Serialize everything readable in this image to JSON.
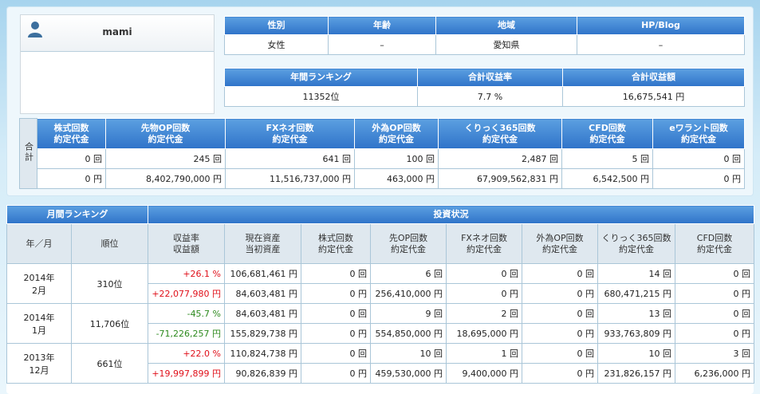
{
  "profile": {
    "name": "mami"
  },
  "info_table": {
    "headers": [
      "性別",
      "年齢",
      "地域",
      "HP/Blog"
    ],
    "values": [
      "女性",
      "–",
      "愛知県",
      "–"
    ]
  },
  "ranking_table": {
    "headers": [
      "年間ランキング",
      "合計収益率",
      "合計収益額"
    ],
    "values": [
      "11352位",
      "7.7 %",
      "16,675,541 円"
    ]
  },
  "totals_table": {
    "side_label": "合計",
    "headers": [
      [
        "株式回数",
        "約定代金"
      ],
      [
        "先物OP回数",
        "約定代金"
      ],
      [
        "FXネオ回数",
        "約定代金"
      ],
      [
        "外為OP回数",
        "約定代金"
      ],
      [
        "くりっく365回数",
        "約定代金"
      ],
      [
        "CFD回数",
        "約定代金"
      ],
      [
        "eワラント回数",
        "約定代金"
      ]
    ],
    "counts": [
      "0 回",
      "245 回",
      "641 回",
      "100 回",
      "2,487 回",
      "5 回",
      "0 回"
    ],
    "amounts": [
      "0 円",
      "8,402,790,000 円",
      "11,516,737,000 円",
      "463,000 円",
      "67,909,562,831 円",
      "6,542,500 円",
      "0 円"
    ]
  },
  "monthly": {
    "group_header_left": "月間ランキング",
    "group_header_right": "投資状況",
    "col_headers": [
      [
        "年／月",
        ""
      ],
      [
        "順位",
        ""
      ],
      [
        "収益率",
        "収益額"
      ],
      [
        "現在資産",
        "当初資産"
      ],
      [
        "株式回数",
        "約定代金"
      ],
      [
        "先OP回数",
        "約定代金"
      ],
      [
        "FXネオ回数",
        "約定代金"
      ],
      [
        "外為OP回数",
        "約定代金"
      ],
      [
        "くりっく365回数",
        "約定代金"
      ],
      [
        "CFD回数",
        "約定代金"
      ]
    ],
    "rows": [
      {
        "year": "2014年",
        "month": "2月",
        "rank": "310位",
        "rate": "+26.1 %",
        "profit": "+22,077,980 円",
        "current": "106,681,461 円",
        "initial": "84,603,481 円",
        "stock_count": "0 回",
        "stock_amount": "0 円",
        "op_count": "6 回",
        "op_amount": "256,410,000 円",
        "fx_count": "0 回",
        "fx_amount": "0 円",
        "gop_count": "0 回",
        "gop_amount": "0 円",
        "k365_count": "14 回",
        "k365_amount": "680,471,215 円",
        "cfd_count": "0 回",
        "cfd_amount": "0 円",
        "sign": "pos"
      },
      {
        "year": "2014年",
        "month": "1月",
        "rank": "11,706位",
        "rate": "-45.7 %",
        "profit": "-71,226,257 円",
        "current": "84,603,481 円",
        "initial": "155,829,738 円",
        "stock_count": "0 回",
        "stock_amount": "0 円",
        "op_count": "9 回",
        "op_amount": "554,850,000 円",
        "fx_count": "2 回",
        "fx_amount": "18,695,000 円",
        "gop_count": "0 回",
        "gop_amount": "0 円",
        "k365_count": "13 回",
        "k365_amount": "933,763,809 円",
        "cfd_count": "0 回",
        "cfd_amount": "0 円",
        "sign": "neg"
      },
      {
        "year": "2013年",
        "month": "12月",
        "rank": "661位",
        "rate": "+22.0 %",
        "profit": "+19,997,899 円",
        "current": "110,824,738 円",
        "initial": "90,826,839 円",
        "stock_count": "0 回",
        "stock_amount": "0 円",
        "op_count": "10 回",
        "op_amount": "459,530,000 円",
        "fx_count": "1 回",
        "fx_amount": "9,400,000 円",
        "gop_count": "0 回",
        "gop_amount": "0 円",
        "k365_count": "10 回",
        "k365_amount": "231,826,157 円",
        "cfd_count": "3 回",
        "cfd_amount": "6,236,000 円",
        "sign": "pos"
      }
    ]
  }
}
